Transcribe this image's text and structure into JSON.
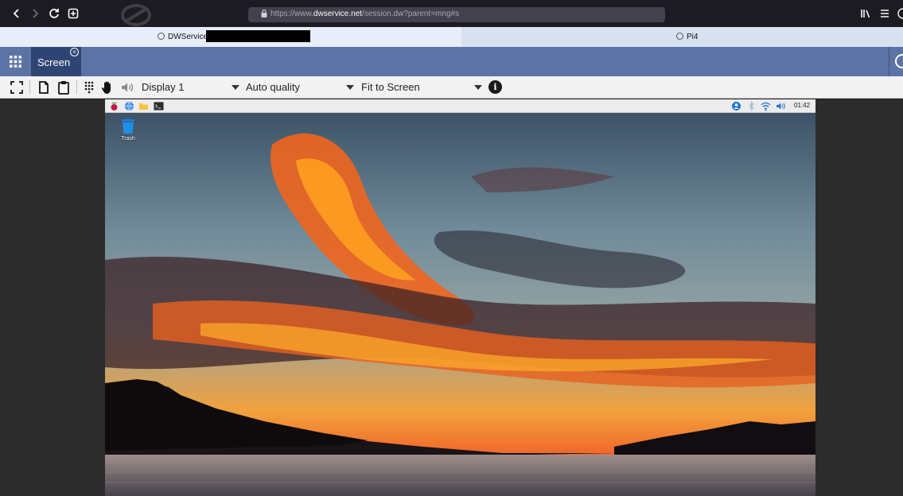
{
  "browser": {
    "url_prefix": "https://www.",
    "url_domain": "dwservice.net",
    "url_path": "/session.dw?parent=mng#s",
    "nav": {
      "back_icon": "chevron-left-icon",
      "forward_icon": "chevron-right-icon",
      "reload_icon": "reload-icon",
      "newtab_icon": "plus-square-icon",
      "library_icon": "library-icon",
      "menu_icon": "hamburger-icon"
    }
  },
  "tabs": [
    {
      "label": "DWService - ",
      "active": true
    },
    {
      "label": "Pi4",
      "active": false
    }
  ],
  "app": {
    "screen_tab_label": "Screen",
    "colors": {
      "header": "#5c73a6",
      "tab_active": "#2e4574"
    }
  },
  "toolbar": {
    "display_select": "Display 1",
    "quality_select": "Auto quality",
    "fit_select": "Fit to Screen",
    "info_label": "i"
  },
  "remote": {
    "desktop_icon_label": "Trash",
    "clock": "01:42"
  }
}
